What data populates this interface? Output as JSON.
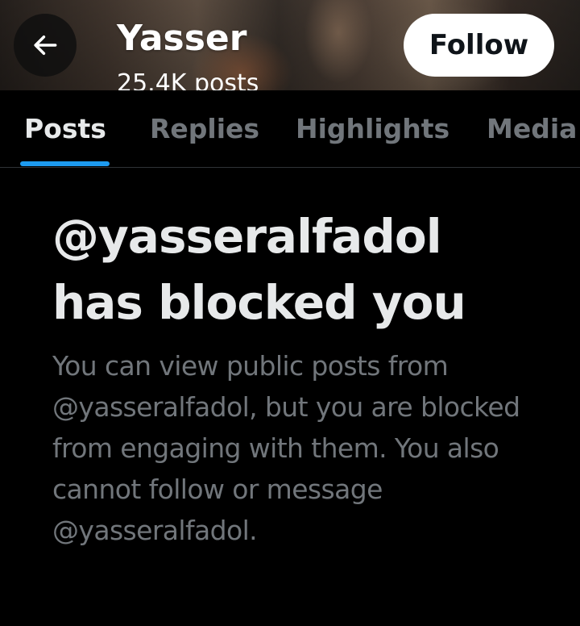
{
  "header": {
    "name": "Yasser",
    "post_count": "25.4K posts",
    "follow_label": "Follow",
    "back_icon": "arrow-left-icon"
  },
  "tabs": [
    {
      "label": "Posts",
      "active": true
    },
    {
      "label": "Replies",
      "active": false
    },
    {
      "label": "Highlights",
      "active": false
    },
    {
      "label": "Media",
      "active": false
    }
  ],
  "blocked": {
    "title_line1": "@yasseralfadol",
    "title_line2": "has blocked you",
    "description": "You can view public posts from @yasseralfadol, but you are blocked from engaging with them. You also cannot follow or message @yasseralfadol."
  },
  "colors": {
    "accent": "#1d9bf0",
    "background": "#000000",
    "primary_text": "#e7e9ea",
    "secondary_text": "#71767b"
  }
}
